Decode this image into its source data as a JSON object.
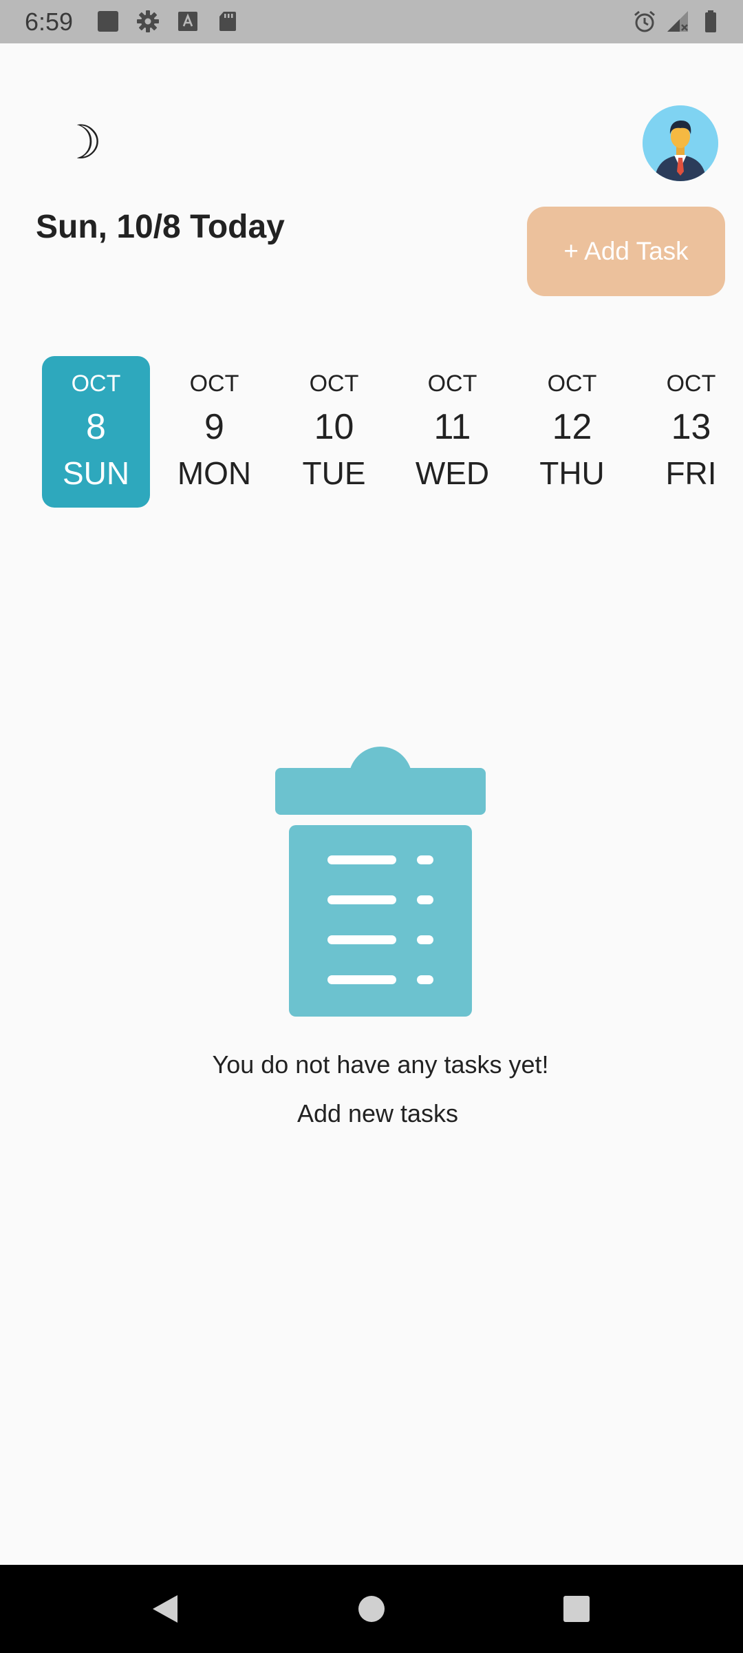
{
  "status_bar": {
    "time": "6:59",
    "icons": [
      "square-notification-icon",
      "gear-icon",
      "keyboard-a-icon",
      "sd-card-icon",
      "alarm-icon",
      "signal-icon",
      "battery-icon"
    ]
  },
  "header": {
    "theme_icon": "☽",
    "date_title": "Sun, 10/8 Today",
    "add_task_label": "+ Add Task"
  },
  "date_strip": [
    {
      "month": "OCT",
      "day": "8",
      "dow": "SUN",
      "selected": true
    },
    {
      "month": "OCT",
      "day": "9",
      "dow": "MON",
      "selected": false
    },
    {
      "month": "OCT",
      "day": "10",
      "dow": "TUE",
      "selected": false
    },
    {
      "month": "OCT",
      "day": "11",
      "dow": "WED",
      "selected": false
    },
    {
      "month": "OCT",
      "day": "12",
      "dow": "THU",
      "selected": false
    },
    {
      "month": "OCT",
      "day": "13",
      "dow": "FRI",
      "selected": false
    }
  ],
  "empty_state": {
    "title": "You do not have any tasks yet!",
    "subtitle": "Add new tasks"
  },
  "colors": {
    "accent": "#2ea8bd",
    "add_task_button": "#ecc19c",
    "illustration": "#6cc2cf",
    "avatar_bg": "#7fd3f2",
    "background": "#fafafa"
  }
}
